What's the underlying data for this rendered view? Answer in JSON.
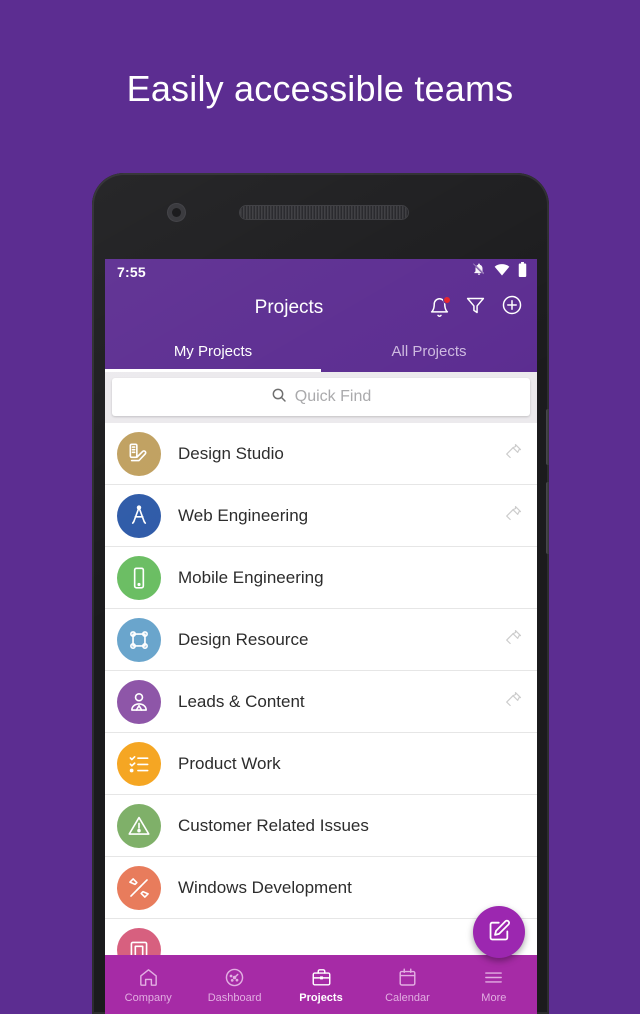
{
  "headline": "Easily accessible teams",
  "status_bar": {
    "time": "7:55",
    "icons": [
      "bell-off-icon",
      "wifi-icon",
      "battery-full-icon"
    ]
  },
  "app_bar": {
    "title": "Projects",
    "actions": [
      {
        "name": "notifications-icon",
        "badge": true
      },
      {
        "name": "filter-icon",
        "badge": false
      },
      {
        "name": "add-circle-icon",
        "badge": false
      }
    ]
  },
  "tabs": [
    {
      "label": "My Projects",
      "active": true
    },
    {
      "label": "All Projects",
      "active": false
    }
  ],
  "search": {
    "placeholder": "Quick Find",
    "value": "",
    "icon": "search-icon"
  },
  "projects": [
    {
      "label": "Design Studio",
      "color": "#C0A060",
      "icon": "palette-icon",
      "pinned": true
    },
    {
      "label": "Web Engineering",
      "color": "#2F5BA8",
      "icon": "compass-icon",
      "pinned": true
    },
    {
      "label": "Mobile Engineering",
      "color": "#6BBE63",
      "icon": "phone-icon",
      "pinned": false
    },
    {
      "label": "Design Resource",
      "color": "#6AA5CC",
      "icon": "vector-icon",
      "pinned": true
    },
    {
      "label": "Leads & Content",
      "color": "#8E56A8",
      "icon": "person-icon",
      "pinned": true
    },
    {
      "label": "Product Work",
      "color": "#F5A623",
      "icon": "checklist-icon",
      "pinned": false
    },
    {
      "label": "Customer Related Issues",
      "color": "#7FB069",
      "icon": "warning-icon",
      "pinned": false
    },
    {
      "label": "Windows Development",
      "color": "#E87C5C",
      "icon": "tools-icon",
      "pinned": false
    },
    {
      "label": "",
      "color": "#D7607F",
      "icon": "archive-icon",
      "pinned": false
    }
  ],
  "fab": {
    "name": "compose-button",
    "icon": "edit-note-icon"
  },
  "bottom_nav": [
    {
      "label": "Company",
      "icon": "home-icon",
      "active": false
    },
    {
      "label": "Dashboard",
      "icon": "dashboard-icon",
      "active": false
    },
    {
      "label": "Projects",
      "icon": "briefcase-icon",
      "active": true
    },
    {
      "label": "Calendar",
      "icon": "calendar-icon",
      "active": false
    },
    {
      "label": "More",
      "icon": "menu-icon",
      "active": false
    }
  ],
  "colors": {
    "background": "#5C2D91",
    "app_bar": "#5C2D91",
    "bottom_nav": "#A62BA6",
    "fab": "#9C27B0",
    "badge": "#E8232A"
  }
}
